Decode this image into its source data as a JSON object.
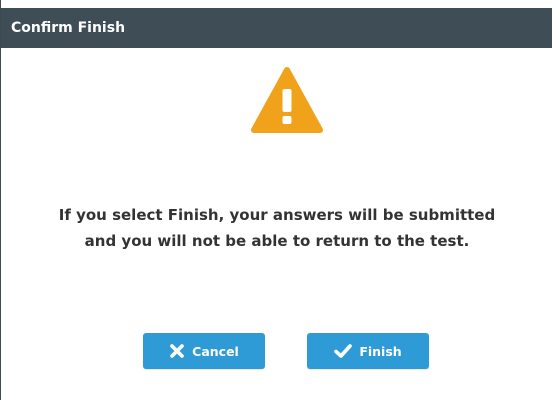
{
  "dialog": {
    "title": "Confirm Finish",
    "icon": "warning-triangle-icon",
    "message_line1": "If you select Finish, your answers will be submitted",
    "message_line2": "and you will not be able to return to the test.",
    "buttons": {
      "cancel_label": "Cancel",
      "cancel_icon": "x-mark-icon",
      "finish_label": "Finish",
      "finish_icon": "checkmark-icon"
    }
  },
  "colors": {
    "titlebar": "#3f4d57",
    "accent": "#2f9bd6",
    "warning": "#f0a21a",
    "text": "#333333"
  }
}
